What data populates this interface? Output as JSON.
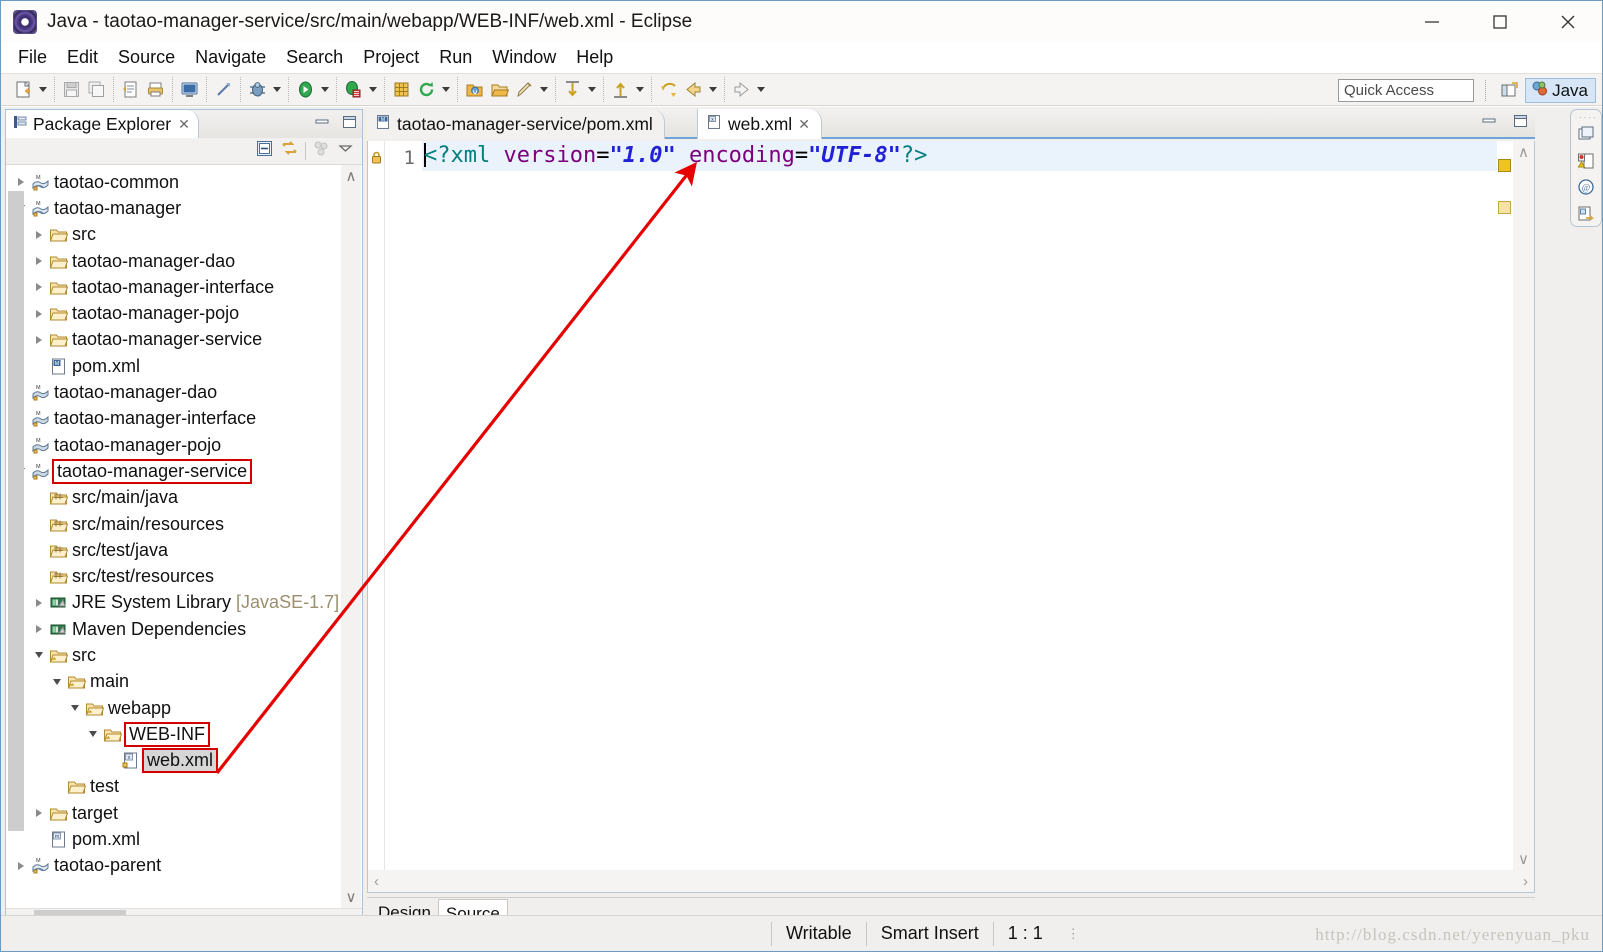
{
  "window": {
    "title": "Java - taotao-manager-service/src/main/webapp/WEB-INF/web.xml - Eclipse",
    "app_icon": "eclipse-icon",
    "minimize": "—",
    "maximize": "□",
    "close": "✕"
  },
  "menu": {
    "items": [
      "File",
      "Edit",
      "Source",
      "Navigate",
      "Search",
      "Project",
      "Run",
      "Window",
      "Help"
    ]
  },
  "toolbar": {
    "quick_access_placeholder": "Quick Access",
    "perspective_label": "Java",
    "groups": [
      {
        "buttons": [
          "new-wizard-icon"
        ],
        "dropdowns": [
          true
        ]
      },
      {
        "buttons": [
          "save-icon",
          "save-all-icon"
        ],
        "dropdowns": [
          false,
          false
        ]
      },
      {
        "buttons": [
          "export-icon",
          "print-icon"
        ],
        "dropdowns": [
          false,
          false
        ]
      },
      {
        "buttons": [
          "console-icon"
        ],
        "dropdowns": [
          false
        ]
      },
      {
        "buttons": [
          "link-icon"
        ],
        "dropdowns": [
          false
        ]
      },
      {
        "buttons": [
          "debug-icon"
        ],
        "dropdowns": [
          true
        ]
      },
      {
        "buttons": [
          "run-icon"
        ],
        "dropdowns": [
          true
        ]
      },
      {
        "buttons": [
          "coverage-icon"
        ],
        "dropdowns": [
          true
        ]
      },
      {
        "buttons": [
          "new-package-icon",
          "refresh-icon"
        ],
        "dropdowns": [
          false,
          true
        ]
      },
      {
        "buttons": [
          "open-type-icon",
          "open-resource-icon",
          "search-icon"
        ],
        "dropdowns": [
          false,
          false,
          true
        ]
      },
      {
        "buttons": [
          "next-annotation-icon"
        ],
        "dropdowns": [
          true
        ]
      },
      {
        "buttons": [
          "prev-annotation-icon"
        ],
        "dropdowns": [
          true
        ]
      },
      {
        "buttons": [
          "last-edit-icon",
          "back-icon"
        ],
        "dropdowns": [
          false,
          true
        ]
      },
      {
        "buttons": [
          "forward-icon"
        ],
        "dropdowns": [
          true
        ]
      }
    ]
  },
  "package_explorer": {
    "tab_label": "Package Explorer",
    "tab_icon": "package-explorer-icon",
    "tab_close": "✕",
    "view_minimize": "▃",
    "view_maximize": "❐",
    "tools": [
      "collapse-all-icon",
      "link-with-editor-icon",
      "view-menu-icon",
      "view-chevron-icon"
    ],
    "tree": [
      {
        "label": "taotao-common",
        "icon": "maven-project-icon",
        "indent": 0,
        "state": "closed",
        "selected": false,
        "highlight": false
      },
      {
        "label": "taotao-manager",
        "icon": "maven-project-icon",
        "indent": 0,
        "state": "open",
        "selected": false,
        "highlight": false
      },
      {
        "label": "src",
        "icon": "folder-icon",
        "indent": 1,
        "state": "closed",
        "selected": false,
        "highlight": false
      },
      {
        "label": "taotao-manager-dao",
        "icon": "folder-icon",
        "indent": 1,
        "state": "closed",
        "selected": false,
        "highlight": false
      },
      {
        "label": "taotao-manager-interface",
        "icon": "folder-icon",
        "indent": 1,
        "state": "closed",
        "selected": false,
        "highlight": false
      },
      {
        "label": "taotao-manager-pojo",
        "icon": "folder-icon",
        "indent": 1,
        "state": "closed",
        "selected": false,
        "highlight": false
      },
      {
        "label": "taotao-manager-service",
        "icon": "folder-icon",
        "indent": 1,
        "state": "closed",
        "selected": false,
        "highlight": false
      },
      {
        "label": "pom.xml",
        "icon": "maven-pom-icon",
        "indent": 1,
        "state": "none",
        "selected": false,
        "highlight": false
      },
      {
        "label": "taotao-manager-dao",
        "icon": "java-project-icon",
        "indent": 0,
        "state": "closed",
        "selected": false,
        "highlight": false
      },
      {
        "label": "taotao-manager-interface",
        "icon": "java-project-icon",
        "indent": 0,
        "state": "closed",
        "selected": false,
        "highlight": false
      },
      {
        "label": "taotao-manager-pojo",
        "icon": "java-project-icon",
        "indent": 0,
        "state": "closed",
        "selected": false,
        "highlight": false
      },
      {
        "label": "taotao-manager-service",
        "icon": "java-project-icon",
        "indent": 0,
        "state": "open",
        "selected": false,
        "highlight": true
      },
      {
        "label": "src/main/java",
        "icon": "source-folder-icon",
        "indent": 1,
        "state": "none",
        "selected": false,
        "highlight": false
      },
      {
        "label": "src/main/resources",
        "icon": "source-folder-icon",
        "indent": 1,
        "state": "none",
        "selected": false,
        "highlight": false
      },
      {
        "label": "src/test/java",
        "icon": "source-folder-icon",
        "indent": 1,
        "state": "none",
        "selected": false,
        "highlight": false
      },
      {
        "label": "src/test/resources",
        "icon": "source-folder-icon",
        "indent": 1,
        "state": "none",
        "selected": false,
        "highlight": false
      },
      {
        "label": "JRE System Library",
        "suffix": " [JavaSE-1.7]",
        "icon": "library-icon",
        "indent": 1,
        "state": "closed",
        "selected": false,
        "highlight": false
      },
      {
        "label": "Maven Dependencies",
        "icon": "library-icon",
        "indent": 1,
        "state": "closed",
        "selected": false,
        "highlight": false
      },
      {
        "label": "src",
        "icon": "folder-link-icon",
        "indent": 1,
        "state": "open",
        "selected": false,
        "highlight": false
      },
      {
        "label": "main",
        "icon": "folder-link-icon",
        "indent": 2,
        "state": "open",
        "selected": false,
        "highlight": false
      },
      {
        "label": "webapp",
        "icon": "folder-link-icon",
        "indent": 3,
        "state": "open",
        "selected": false,
        "highlight": false
      },
      {
        "label": "WEB-INF",
        "icon": "folder-link-icon",
        "indent": 4,
        "state": "open",
        "selected": false,
        "highlight": true
      },
      {
        "label": "web.xml",
        "icon": "xml-file-icon",
        "indent": 5,
        "state": "none",
        "selected": true,
        "highlight": true
      },
      {
        "label": "test",
        "icon": "folder-icon",
        "indent": 2,
        "state": "none",
        "selected": false,
        "highlight": false
      },
      {
        "label": "target",
        "icon": "folder-icon",
        "indent": 1,
        "state": "closed",
        "selected": false,
        "highlight": false
      },
      {
        "label": "pom.xml",
        "icon": "xml-file-plain-icon",
        "indent": 1,
        "state": "none",
        "selected": false,
        "highlight": false
      },
      {
        "label": "taotao-parent",
        "icon": "maven-project-icon",
        "indent": 0,
        "state": "closed",
        "selected": false,
        "highlight": false
      }
    ],
    "scroll": {
      "up": "∧",
      "down": "∨",
      "left": "‹",
      "right": "›"
    }
  },
  "editor": {
    "tabs": [
      {
        "label": "taotao-manager-service/pom.xml",
        "icon": "maven-pom-icon",
        "active": false,
        "closable": false
      },
      {
        "label": "web.xml",
        "icon": "xml-file-icon",
        "active": true,
        "closable": true,
        "close": "✕"
      }
    ],
    "view_minimize": "▃",
    "view_maximize": "❐",
    "line_number": "1",
    "marker_icon": "readonly-lock-icon",
    "code": {
      "open_bracket": "<?",
      "tag": "xml",
      "attr1_name": " version",
      "attr1_eq": "=",
      "attr1_value": "\"1.0\"",
      "attr2_name": " encoding",
      "attr2_eq": "=",
      "attr2_value": "\"UTF-8\"",
      "close_bracket": "?>",
      "full_text": "<?xml version=\"1.0\" encoding=\"UTF-8\"?>"
    },
    "annotations": [
      "warning-marker",
      "info-marker"
    ],
    "form_tabs": [
      {
        "label": "Design",
        "active": false
      },
      {
        "label": "Source",
        "active": true
      }
    ],
    "scroll": {
      "up": "∧",
      "down": "∨",
      "left": "‹",
      "right": "›"
    }
  },
  "fastview": {
    "icons": [
      "restore-view-icon",
      "problems-view-icon",
      "javadoc-view-icon",
      "declaration-view-icon"
    ]
  },
  "statusbar": {
    "writable": "Writable",
    "insert_mode": "Smart Insert",
    "position": "1 : 1",
    "watermark": "http://blog.csdn.net/yerenyuan_pku"
  },
  "annotation": {
    "arrow_color": "#e60000",
    "highlight_color": "#d40000"
  }
}
